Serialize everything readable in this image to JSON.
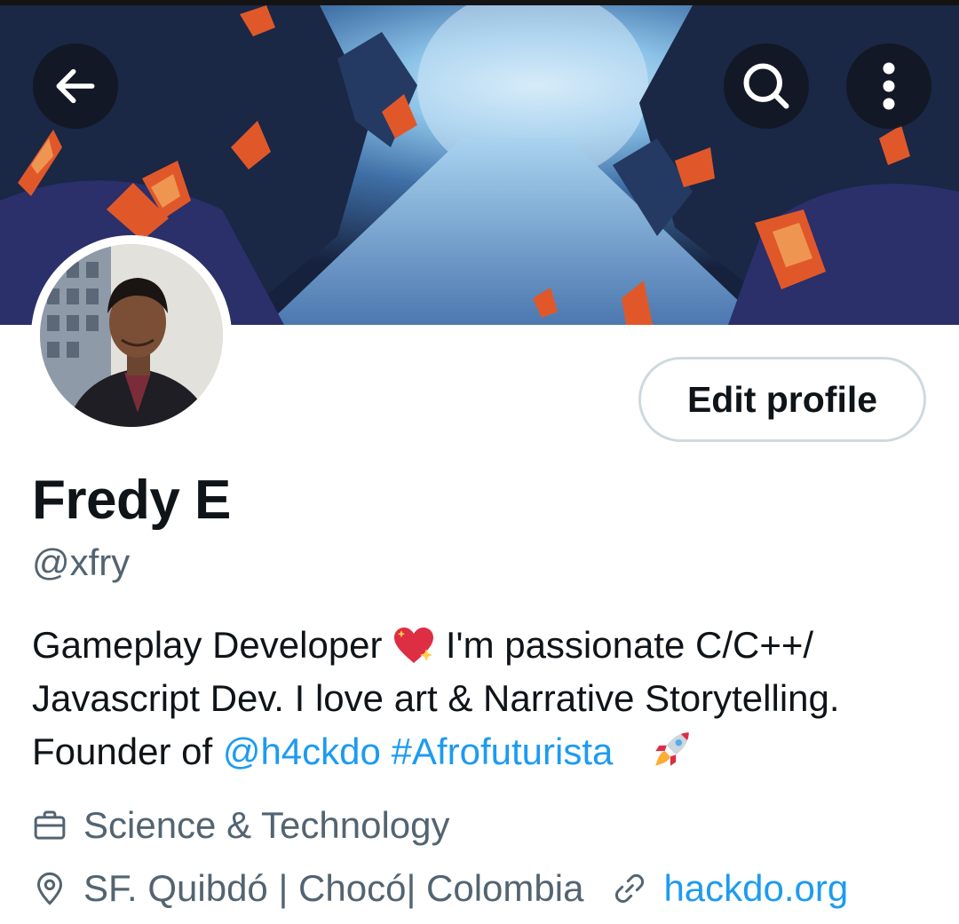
{
  "header": {
    "back_icon": "arrow-left-icon",
    "search_icon": "search-icon",
    "more_icon": "more-vertical-icon"
  },
  "profile": {
    "display_name": "Fredy E",
    "handle": "@xfry",
    "edit_button_label": "Edit profile"
  },
  "bio": {
    "line1_text": "Gameplay Developer",
    "line1_emoji": "sparkling-heart-icon",
    "line1_rest": "I'm passionate C/C++/",
    "line2_text": "Javascript Dev. I love art & Narrative Storytelling.",
    "line3_prefix": "Founder of",
    "mention": "@h4ckdo",
    "hashtag": "#Afrofuturista",
    "line3_emoji": "rocket-icon"
  },
  "details": {
    "category": "Science & Technology",
    "category_icon": "briefcase-icon",
    "location": "SF. Quibdó | Chocó| Colombia",
    "location_icon": "location-pin-icon",
    "website": "hackdo.org",
    "website_icon": "link-icon"
  },
  "colors": {
    "accent": "#1d9bf0",
    "secondary_text": "#536471",
    "primary_text": "#0f1419",
    "button_border": "#cfd9de"
  }
}
